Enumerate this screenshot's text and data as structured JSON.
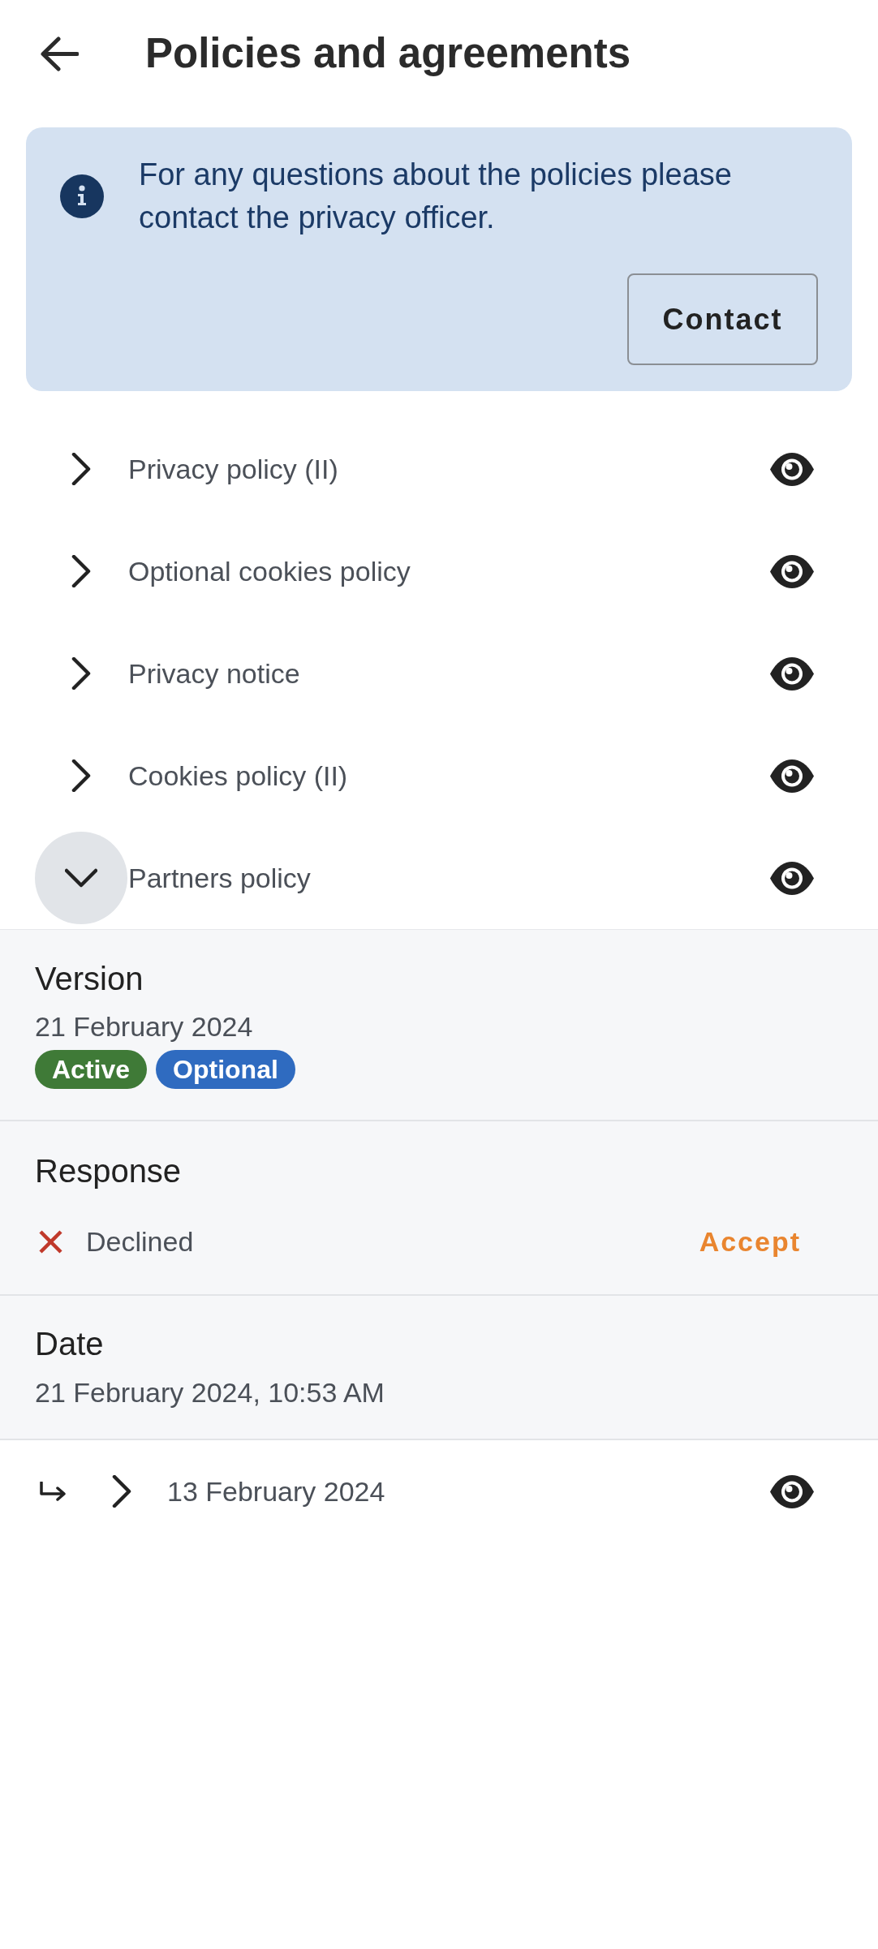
{
  "header": {
    "title": "Policies and agreements"
  },
  "notice": {
    "text": "For any questions about the policies please contact the privacy officer.",
    "button": "Contact"
  },
  "policies": [
    {
      "title": "Privacy policy (II)",
      "expanded": false
    },
    {
      "title": "Optional cookies policy",
      "expanded": false
    },
    {
      "title": "Privacy notice",
      "expanded": false
    },
    {
      "title": "Cookies policy (II)",
      "expanded": false
    },
    {
      "title": "Partners policy",
      "expanded": true,
      "details": {
        "version": {
          "label": "Version",
          "value": "21 February 2024",
          "tags": [
            {
              "label": "Active",
              "color": "#3f7a37"
            },
            {
              "label": "Optional",
              "color": "#2f6bc0"
            }
          ]
        },
        "response": {
          "label": "Response",
          "accepted": false,
          "status": "Declined",
          "action": "Accept"
        },
        "date": {
          "label": "Date",
          "value": "21 February 2024, 10:53 AM"
        },
        "history": [
          {
            "title": "13 February 2024",
            "expanded": false
          }
        ]
      }
    }
  ]
}
